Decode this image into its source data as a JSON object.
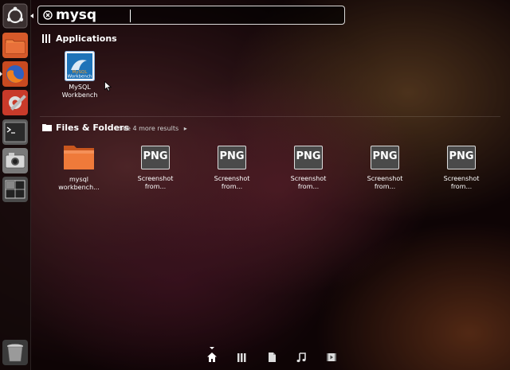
{
  "search": {
    "query": "mysq"
  },
  "launcher": {
    "items": [
      {
        "icon": "ubuntu-logo-icon"
      },
      {
        "icon": "home-folder-icon"
      },
      {
        "icon": "firefox-icon"
      },
      {
        "icon": "system-settings-icon"
      },
      {
        "icon": "terminal-icon"
      },
      {
        "icon": "screenshot-camera-icon"
      },
      {
        "icon": "workspace-switcher-icon"
      },
      {
        "icon": "trash-icon"
      }
    ]
  },
  "applications": {
    "heading": "Applications",
    "items": [
      {
        "label_line1": "MySQL",
        "label_line2": "Workbench",
        "icon_text_top": "MySQL",
        "icon_text_bottom": "Workbench"
      }
    ]
  },
  "files": {
    "heading": "Files & Folders",
    "more": "See 4 more results",
    "items": [
      {
        "type": "folder",
        "label_line1": "mysql",
        "label_line2": "workbench..."
      },
      {
        "type": "png",
        "badge": "PNG",
        "label_line1": "Screenshot",
        "label_line2": "from..."
      },
      {
        "type": "png",
        "badge": "PNG",
        "label_line1": "Screenshot",
        "label_line2": "from..."
      },
      {
        "type": "png",
        "badge": "PNG",
        "label_line1": "Screenshot",
        "label_line2": "from..."
      },
      {
        "type": "png",
        "badge": "PNG",
        "label_line1": "Screenshot",
        "label_line2": "from..."
      },
      {
        "type": "png",
        "badge": "PNG",
        "label_line1": "Screenshot",
        "label_line2": "from..."
      }
    ]
  },
  "lenses": [
    "home-lens-icon",
    "applications-lens-icon",
    "files-lens-icon",
    "music-lens-icon",
    "video-lens-icon"
  ],
  "colors": {
    "accent": "#e05a2b",
    "panel": "#140a0a"
  }
}
